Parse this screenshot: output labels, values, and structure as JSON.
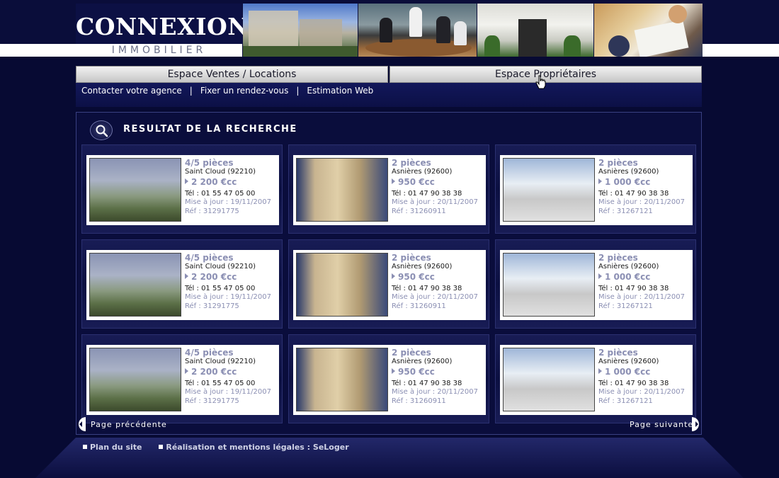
{
  "header": {
    "logo_main": "CONNEXION",
    "logo_sub": "IMMOBILIER"
  },
  "nav": {
    "tab_ventes": "Espace Ventes / Locations",
    "tab_proprietaires": "Espace Propriétaires",
    "sub_links": [
      "Contacter votre agence",
      "Fixer un rendez-vous",
      "Estimation Web"
    ],
    "separator": "|"
  },
  "results": {
    "title": "RESULTAT DE LA RECHERCHE",
    "listings": [
      {
        "pieces": "4/5 pièces",
        "city": "Saint Cloud (92210)",
        "price": "2 200 €cc",
        "tel": "Tél : 01 55 47 05 00",
        "maj": "Mise à jour : 19/11/2007",
        "ref": "Réf : 31291775",
        "image": "saint-cloud-view"
      },
      {
        "pieces": "2 pièces",
        "city": "Asnières (92600)",
        "price": "950 €cc",
        "tel": "Tél : 01 47 90 38 38",
        "maj": "Mise à jour : 20/11/2007",
        "ref": "Réf : 31260911",
        "image": "asnieres-building"
      },
      {
        "pieces": "2 pièces",
        "city": "Asnières (92600)",
        "price": "1 000 €cc",
        "tel": "Tél : 01 47 90 38 38",
        "maj": "Mise à jour : 20/11/2007",
        "ref": "Réf : 31267121",
        "image": "asnieres-sketch"
      },
      {
        "pieces": "4/5 pièces",
        "city": "Saint Cloud (92210)",
        "price": "2 200 €cc",
        "tel": "Tél : 01 55 47 05 00",
        "maj": "Mise à jour : 19/11/2007",
        "ref": "Réf : 31291775",
        "image": "saint-cloud-view"
      },
      {
        "pieces": "2 pièces",
        "city": "Asnières (92600)",
        "price": "950 €cc",
        "tel": "Tél : 01 47 90 38 38",
        "maj": "Mise à jour : 20/11/2007",
        "ref": "Réf : 31260911",
        "image": "asnieres-building"
      },
      {
        "pieces": "2 pièces",
        "city": "Asnières (92600)",
        "price": "1 000 €cc",
        "tel": "Tél : 01 47 90 38 38",
        "maj": "Mise à jour : 20/11/2007",
        "ref": "Réf : 31267121",
        "image": "asnieres-sketch"
      },
      {
        "pieces": "4/5 pièces",
        "city": "Saint Cloud (92210)",
        "price": "2 200 €cc",
        "tel": "Tél : 01 55 47 05 00",
        "maj": "Mise à jour : 19/11/2007",
        "ref": "Réf : 31291775",
        "image": "saint-cloud-view"
      },
      {
        "pieces": "2 pièces",
        "city": "Asnières (92600)",
        "price": "950 €cc",
        "tel": "Tél : 01 47 90 38 38",
        "maj": "Mise à jour : 20/11/2007",
        "ref": "Réf : 31260911",
        "image": "asnieres-building"
      },
      {
        "pieces": "2 pièces",
        "city": "Asnières (92600)",
        "price": "1 000 €cc",
        "tel": "Tél : 01 47 90 38 38",
        "maj": "Mise à jour : 20/11/2007",
        "ref": "Réf : 31267121",
        "image": "asnieres-sketch"
      }
    ]
  },
  "pagination": {
    "prev": "Page précédente",
    "next": "Page suivante"
  },
  "footer": {
    "plan": "Plan du site",
    "legal": "Réalisation et mentions légales : SeLoger"
  },
  "icons": {
    "search": "magnifier-icon",
    "prev": "arrow-left-icon",
    "next": "arrow-right-icon",
    "cursor": "hand-cursor-icon"
  }
}
